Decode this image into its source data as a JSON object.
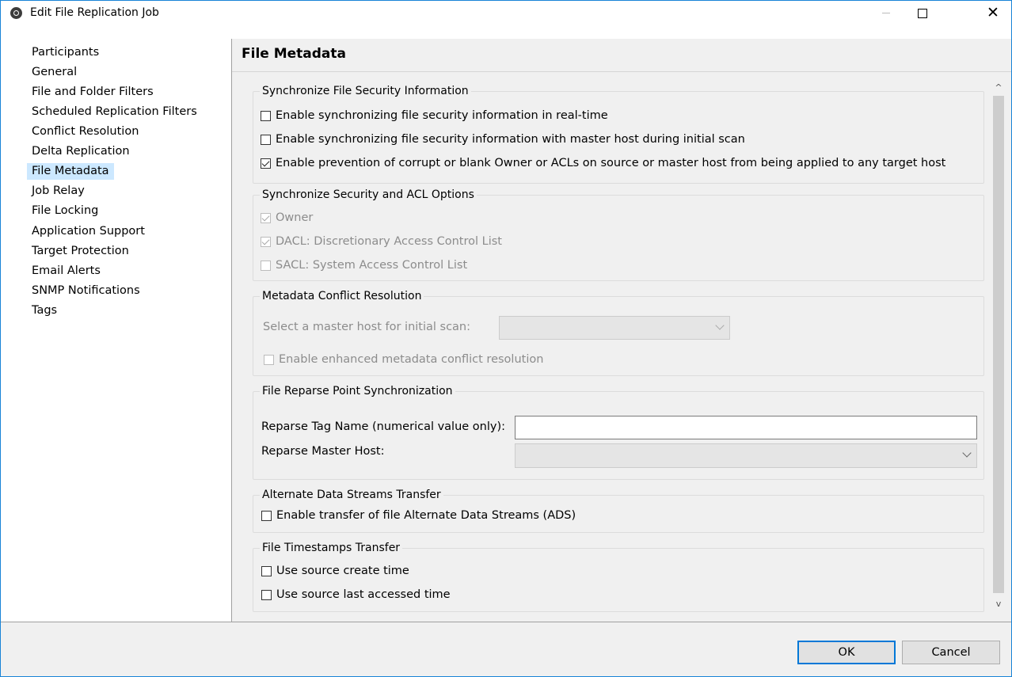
{
  "window": {
    "title": "Edit File Replication Job"
  },
  "titlebar": {
    "minimize": "—",
    "close": "✕"
  },
  "nav": {
    "items": [
      "Participants",
      "General",
      "File and Folder Filters",
      "Scheduled Replication Filters",
      "Conflict Resolution",
      "Delta Replication",
      "File Metadata",
      "Job Relay",
      "File Locking",
      "Application Support",
      "Target Protection",
      "Email Alerts",
      "SNMP Notifications",
      "Tags"
    ],
    "selected": "File Metadata"
  },
  "main": {
    "title": "File Metadata"
  },
  "sync_security": {
    "legend": "Synchronize File Security Information",
    "realtime": "Enable synchronizing file security information in real-time",
    "master_scan": "Enable synchronizing file security information with master host during initial scan",
    "prevent_corrupt": "Enable prevention of corrupt or blank Owner or ACLs on source or master host from being applied to any target host"
  },
  "acl_options": {
    "legend": "Synchronize Security and ACL Options",
    "owner": "Owner",
    "dacl": "DACL: Discretionary Access Control List",
    "sacl": "SACL: System Access Control List"
  },
  "metadata_conflict": {
    "legend": "Metadata Conflict Resolution",
    "master_label": "Select a master host for initial scan:",
    "master_value": "",
    "enhanced": "Enable enhanced metadata conflict resolution"
  },
  "reparse": {
    "legend": "File Reparse Point Synchronization",
    "tag_label": "Reparse Tag Name (numerical value only):",
    "tag_value": "",
    "master_label": "Reparse Master Host:",
    "master_value": ""
  },
  "ads": {
    "legend": "Alternate Data Streams Transfer",
    "enable": "Enable transfer of file Alternate Data Streams (ADS)"
  },
  "timestamps": {
    "legend": "File Timestamps Transfer",
    "create": "Use source create time",
    "accessed": "Use source last accessed time"
  },
  "scrollbar": {
    "up": "^",
    "down": "v"
  },
  "footer": {
    "ok": "OK",
    "cancel": "Cancel"
  }
}
